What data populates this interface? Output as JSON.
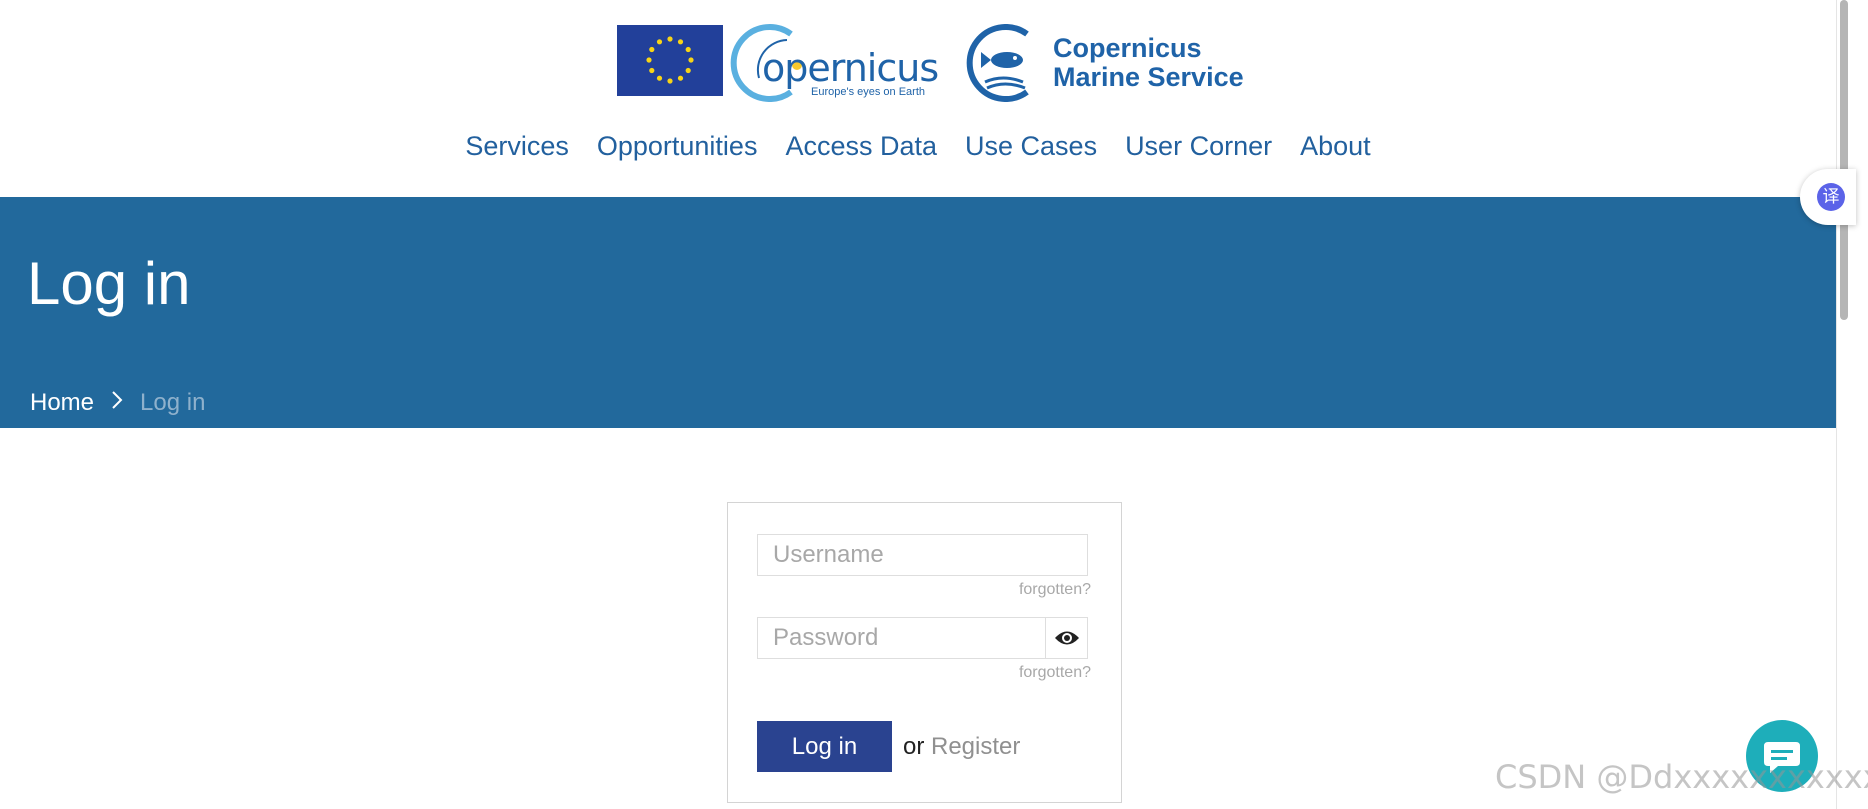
{
  "header": {
    "copernicus_logo_text": "opernicus",
    "copernicus_tagline": "Europe's eyes on Earth",
    "marine_service_line1": "Copernicus",
    "marine_service_line2": "Marine Service"
  },
  "nav": {
    "items": [
      {
        "label": "Services"
      },
      {
        "label": "Opportunities"
      },
      {
        "label": "Access Data"
      },
      {
        "label": "Use Cases"
      },
      {
        "label": "User Corner"
      },
      {
        "label": "About"
      }
    ]
  },
  "banner": {
    "title": "Log in",
    "breadcrumb": {
      "home": "Home",
      "current": "Log in"
    }
  },
  "login_form": {
    "username_placeholder": "Username",
    "username_forgotten": "forgotten?",
    "password_placeholder": "Password",
    "password_forgotten": "forgotten?",
    "submit_label": "Log in",
    "or_text": "or",
    "register_label": "Register"
  },
  "translate_widget": {
    "glyph": "译"
  },
  "watermark": "CSDN @Ddxxxxxxxxxxxx",
  "colors": {
    "nav_text": "#22609e",
    "banner_bg": "#22699c",
    "login_button": "#2a4390",
    "chat_button": "#1eaeba"
  },
  "icons": {
    "eye": "eye-icon",
    "chat": "chat-icon",
    "breadcrumb_separator": "chevron-right-icon",
    "translate": "translate-icon"
  }
}
